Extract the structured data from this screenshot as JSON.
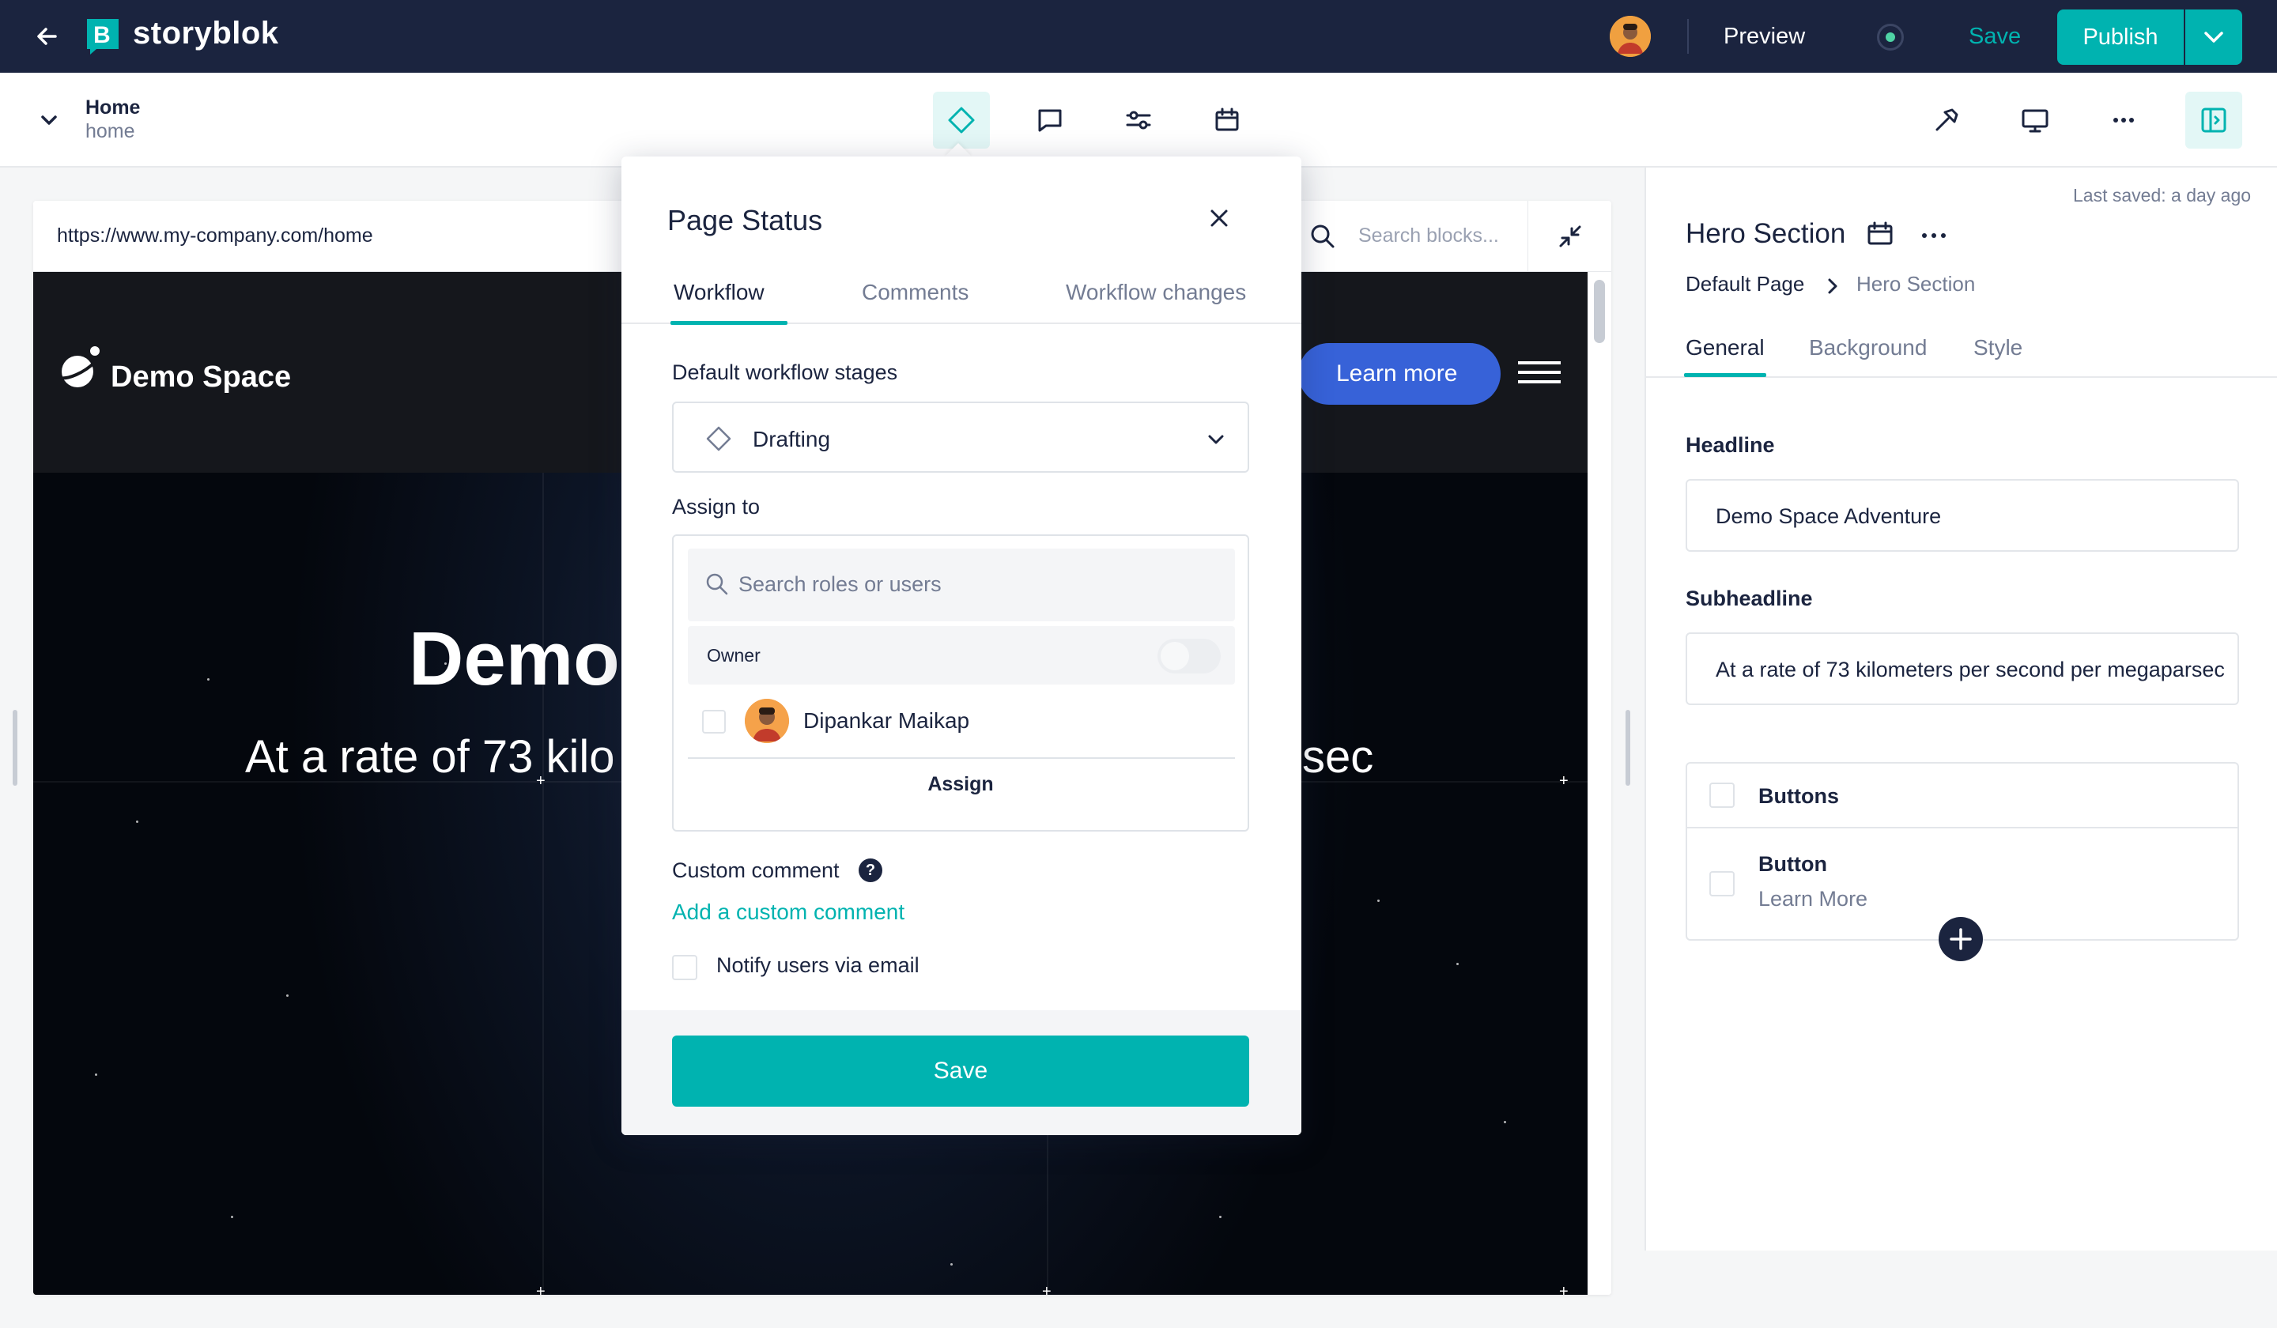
{
  "topbar": {
    "brand": "storyblok",
    "preview_label": "Preview",
    "save_label": "Save",
    "publish_label": "Publish",
    "accent": "#00b3b0",
    "bg": "#1b243f"
  },
  "story": {
    "title": "Home",
    "slug": "home"
  },
  "preview": {
    "url": "https://www.my-company.com/home",
    "search_placeholder": "Search blocks...",
    "site_brand": "Demo Space",
    "learn_more": "Learn more",
    "headline_visible": "Demo",
    "subheadline_left": "At a rate of 73 kilo",
    "subheadline_right": "sec"
  },
  "modal": {
    "title": "Page Status",
    "tabs": [
      {
        "label": "Workflow",
        "active": true
      },
      {
        "label": "Comments",
        "active": false
      },
      {
        "label": "Workflow changes",
        "active": false
      }
    ],
    "workflow_label": "Default workflow stages",
    "workflow_value": "Drafting",
    "assign_label": "Assign to",
    "search_placeholder": "Search roles or users",
    "owner_label": "Owner",
    "user_name": "Dipankar Maikap",
    "assign_button": "Assign",
    "custom_comment_label": "Custom comment",
    "help_glyph": "?",
    "add_comment_link": "Add a custom comment",
    "notify_label": "Notify users via email",
    "save_button": "Save"
  },
  "right_panel": {
    "last_saved": "Last saved: a day ago",
    "title": "Hero Section",
    "breadcrumb": [
      "Default Page",
      "Hero Section"
    ],
    "tabs": [
      {
        "label": "General",
        "active": true
      },
      {
        "label": "Background",
        "active": false
      },
      {
        "label": "Style",
        "active": false
      }
    ],
    "headline_label": "Headline",
    "headline_value": "Demo Space Adventure",
    "subheadline_label": "Subheadline",
    "subheadline_value": "At a rate of 73 kilometers per second per megaparsec",
    "buttons_label": "Buttons",
    "button_label": "Button",
    "button_value": "Learn More"
  },
  "icons": [
    "back-arrow-icon",
    "storyblok-logo-icon",
    "diamond-status-icon",
    "comment-icon",
    "sliders-icon",
    "calendar-icon",
    "hammer-icon",
    "monitor-icon",
    "more-icon",
    "panel-toggle-icon",
    "search-icon",
    "collapse-icon",
    "close-icon",
    "chevron-down-icon",
    "plus-icon"
  ]
}
